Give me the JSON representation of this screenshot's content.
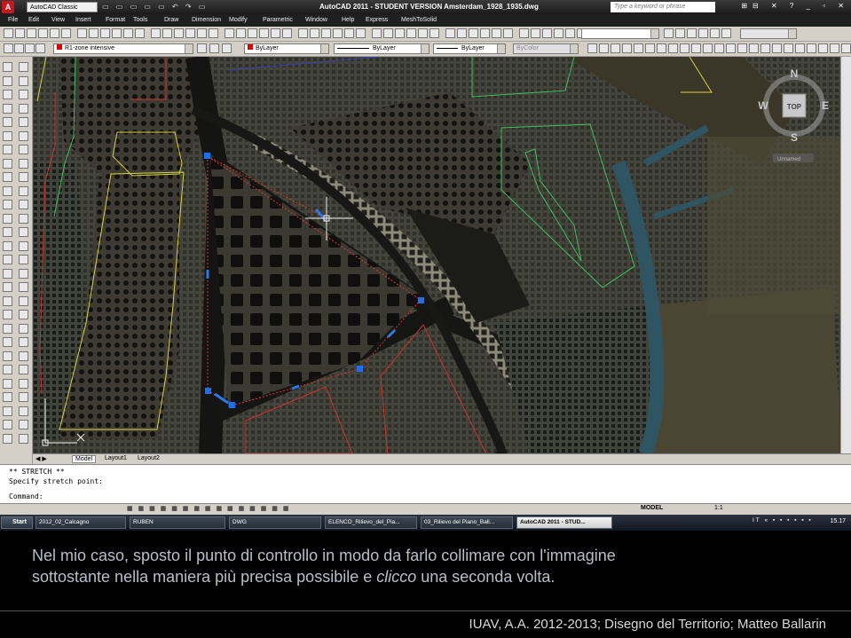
{
  "titlebar": {
    "workspace": "AutoCAD Classic",
    "title": "AutoCAD 2011 - STUDENT VERSION    Amsterdam_1928_1935.dwg",
    "search_placeholder": "Type a keyword or phrase"
  },
  "menus": [
    "File",
    "Edit",
    "View",
    "Insert",
    "Format",
    "Tools",
    "Draw",
    "Dimension",
    "Modify",
    "Parametric",
    "Window",
    "Help",
    "Express",
    "MeshToSolid"
  ],
  "properties": {
    "layer": "R1-zone intensive",
    "color": "ByLayer",
    "linetype": "ByLayer",
    "lineweight": "ByLayer",
    "plotstyle": "ByColor"
  },
  "viewcube": {
    "north": "N",
    "south": "S",
    "east": "E",
    "west": "W",
    "face": "TOP",
    "ucs": "Unnamed"
  },
  "layout_tabs": [
    "Model",
    "Layout1",
    "Layout2"
  ],
  "command_lines": [
    "** STRETCH **",
    "Specify stretch point:",
    "Command:"
  ],
  "status": {
    "model": "MODEL",
    "scale": "1:1"
  },
  "taskbar": {
    "start": "Start",
    "items": [
      "2012_02_Calcagno",
      "RUBEN",
      "DWG",
      "ELENCO_Rilievo_del_Pia...",
      "03_Rilievo del Piano_Ball...",
      "AutoCAD 2011 - STUD..."
    ],
    "clock": "15.17"
  },
  "caption": {
    "line1": "Nel mio caso, sposto il punto di controllo in modo da farlo collimare con l'immagine",
    "line2_before": "sottostante nella maniera più precisa possibile e ",
    "line2_em": "clicco",
    "line2_after": " una seconda volta."
  },
  "footer": "IUAV, A.A. 2012-2013; Disegno del Territorio; Matteo Ballarin"
}
